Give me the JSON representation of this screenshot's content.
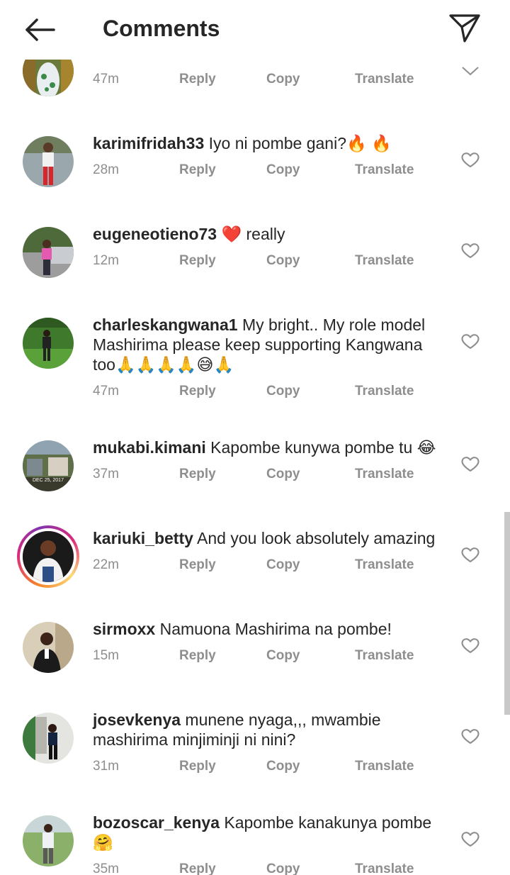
{
  "header": {
    "title": "Comments"
  },
  "actions": {
    "reply": "Reply",
    "copy": "Copy",
    "translate": "Translate"
  },
  "comments": [
    {
      "username": "",
      "text": "",
      "time": "47m",
      "avatar": "photo-green"
    },
    {
      "username": "karimifridah33",
      "text": "Iyo ni pombe gani?🔥 🔥",
      "time": "28m",
      "avatar": "photo-red-jeans"
    },
    {
      "username": "eugeneotieno73",
      "text": "❤️ really",
      "time": "12m",
      "avatar": "photo-car"
    },
    {
      "username": "charleskangwana1",
      "text": "My bright.. My role model Mashirima please keep supporting Kangwana too🙏🙏🙏🙏😅🙏",
      "time": "47m",
      "avatar": "photo-grass"
    },
    {
      "username": "mukabi.kimani",
      "text": "Kapombe kunywa pombe tu 😂",
      "time": "37m",
      "avatar": "photo-date",
      "avatar_caption": "DEC 25, 2017"
    },
    {
      "username": "kariuki_betty",
      "text": "And you look absolutely amazing",
      "time": "22m",
      "avatar": "photo-story"
    },
    {
      "username": "sirmoxx",
      "text": "Namuona Mashirima na pombe!",
      "time": "15m",
      "avatar": "photo-suit"
    },
    {
      "username": "josevkenya",
      "text": "munene nyaga,,, mwambie mashirima minjiminji ni nini?",
      "time": "31m",
      "avatar": "photo-wall"
    },
    {
      "username": "bozoscar_kenya",
      "text": "Kapombe kanakunya pombe 🤗",
      "time": "35m",
      "avatar": "photo-outdoor"
    }
  ],
  "icons": {
    "back": "arrow-left-icon",
    "send": "paper-plane-icon",
    "like": "heart-outline-icon",
    "expand": "chevron-down-icon"
  }
}
